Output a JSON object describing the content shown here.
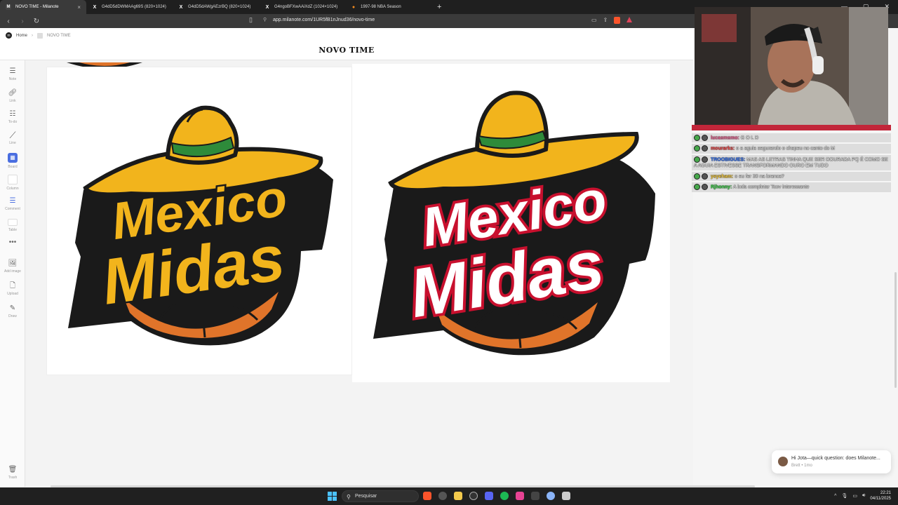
{
  "browser": {
    "tabs": [
      {
        "label": "NOVO TIME - Milanote",
        "icon": "milanote-icon",
        "active": true
      },
      {
        "label": "G4dD5dDWMAAg69S (820×1024)",
        "icon": "x-icon"
      },
      {
        "label": "G4dD5dAWgAEzrBQ (820×1024)",
        "icon": "x-icon"
      },
      {
        "label": "G4ngoBFXwAAiXdZ (1024×1024)",
        "icon": "x-icon"
      },
      {
        "label": "1997-98 NBA Season",
        "icon": "basketball-reference-icon"
      }
    ],
    "close_glyph": "×",
    "new_tab": "+",
    "url": "app.milanote.com/1UR5fB1nJnud36/novo-time"
  },
  "app": {
    "breadcrumb_home": "Home",
    "breadcrumb_current": "NOVO TIME",
    "page_title": "NOVO TIME"
  },
  "toolbar": [
    {
      "label": "Note",
      "icon": "note-icon"
    },
    {
      "label": "Link",
      "icon": "link-icon"
    },
    {
      "label": "To-do",
      "icon": "todo-icon"
    },
    {
      "label": "Line",
      "icon": "line-icon"
    },
    {
      "label": "Board",
      "icon": "board-icon"
    },
    {
      "label": "Column",
      "icon": "column-icon"
    },
    {
      "label": "Comment",
      "icon": "comment-icon"
    },
    {
      "label": "Table",
      "icon": "table-icon"
    },
    {
      "label": "",
      "icon": "more-icon"
    },
    {
      "label": "Add image",
      "icon": "add-image-icon"
    },
    {
      "label": "Upload",
      "icon": "upload-icon"
    },
    {
      "label": "Draw",
      "icon": "draw-icon"
    },
    {
      "label": "Trash",
      "icon": "trash-icon"
    }
  ],
  "logos": [
    {
      "line1": "Mexico",
      "line2": "Midas",
      "style": "gold"
    },
    {
      "line1": "Mexico",
      "line2": "Midas",
      "style": "white-red"
    }
  ],
  "colors": {
    "gold": "#f2b41c",
    "gold_dark": "#c47f0c",
    "red": "#c8102e",
    "green": "#2e8b3a",
    "ball": "#e0742a",
    "outline": "#1a1a1a",
    "stream_bar": "#c2263a"
  },
  "chat": [
    {
      "user": "lucasmsmo:",
      "text": "G O L D",
      "user_color": "#ff6b9d"
    },
    {
      "user": "mourarks:",
      "text": "o a aguia segurando o chapeu no canto do M",
      "user_color": "#ff4d4d"
    },
    {
      "user": "TROOBIGUES:",
      "text": "MAS AS LETRAS TINHA QUE SER DOURADA PQ É COMO SE A AGUIA ESTIVESSE TRANSFORMANDO OURO EM TUDO",
      "user_color": "#3d7cff"
    },
    {
      "user": "yeyeham:",
      "text": "o eu fer 30 na branca?",
      "user_color": "#ffd23d"
    },
    {
      "user": "Rjhonny:",
      "text": "A bola completar Tcov interessante",
      "user_color": "#3ddc4a"
    }
  ],
  "toast": {
    "message": "Hi Jota—quick question: does Milanote...",
    "meta": "Brett • 1mo"
  },
  "taskbar": {
    "search_placeholder": "Pesquisar",
    "time": "22:21",
    "date": "04/11/2025"
  }
}
